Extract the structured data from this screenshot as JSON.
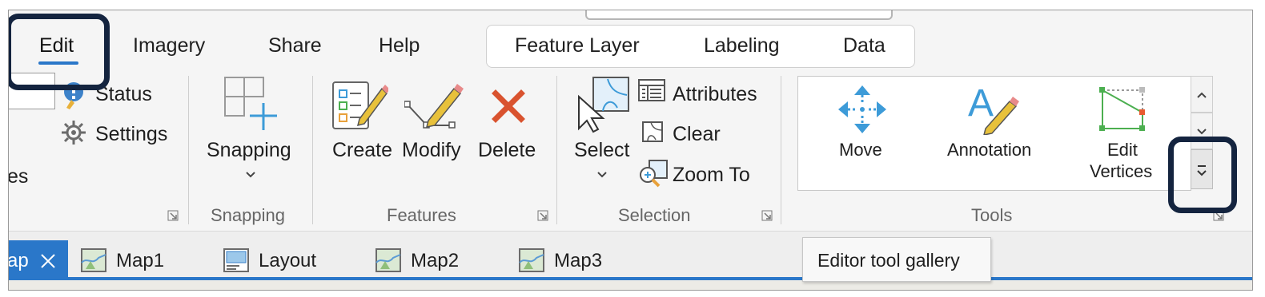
{
  "tabs": {
    "edit": "Edit",
    "imagery": "Imagery",
    "share": "Share",
    "help": "Help"
  },
  "contextual_tabs": {
    "feature_layer": "Feature Layer",
    "labeling": "Labeling",
    "data": "Data"
  },
  "ribbon": {
    "manage": {
      "status": "Status",
      "settings": "Settings",
      "partial_label": "es"
    },
    "snapping": {
      "button": "Snapping",
      "group": "Snapping"
    },
    "features": {
      "create": "Create",
      "modify": "Modify",
      "delete": "Delete",
      "group": "Features"
    },
    "selection": {
      "select": "Select",
      "attributes": "Attributes",
      "clear": "Clear",
      "zoom_to": "Zoom To",
      "group": "Selection"
    },
    "tools": {
      "move": "Move",
      "annotation": "Annotation",
      "edit_vertices_line1": "Edit",
      "edit_vertices_line2": "Vertices",
      "group": "Tools"
    }
  },
  "view_tabs": {
    "active_partial": "ap",
    "map1": "Map1",
    "layout": "Layout",
    "map2": "Map2",
    "map3": "Map3"
  },
  "tooltip": "Editor tool gallery",
  "colors": {
    "accent_blue": "#2a77c9",
    "delete_red": "#d9532f",
    "callout_navy": "#14243f",
    "tool_blue": "#3d9bd8"
  }
}
